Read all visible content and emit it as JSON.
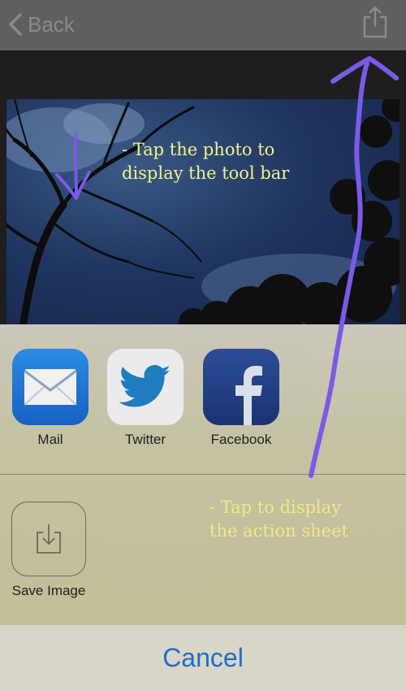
{
  "topbar": {
    "back_label": "Back"
  },
  "annotations": {
    "photo_hint": "- Tap the photo to\ndisplay the tool bar",
    "sheet_hint": "- Tap to display\nthe action sheet"
  },
  "share_apps": [
    {
      "label": "Mail",
      "icon": "mail-icon"
    },
    {
      "label": "Twitter",
      "icon": "twitter-bird-icon"
    },
    {
      "label": "Facebook",
      "icon": "facebook-icon"
    }
  ],
  "actions": [
    {
      "label": "Save Image",
      "icon": "save-image-icon"
    }
  ],
  "cancel_label": "Cancel",
  "colors": {
    "topbar": "#5f5f60",
    "accent_blue": "#1e6fc8",
    "annotation_yellow": "#f3f18a",
    "annotation_arrow": "#7a5ae6"
  }
}
